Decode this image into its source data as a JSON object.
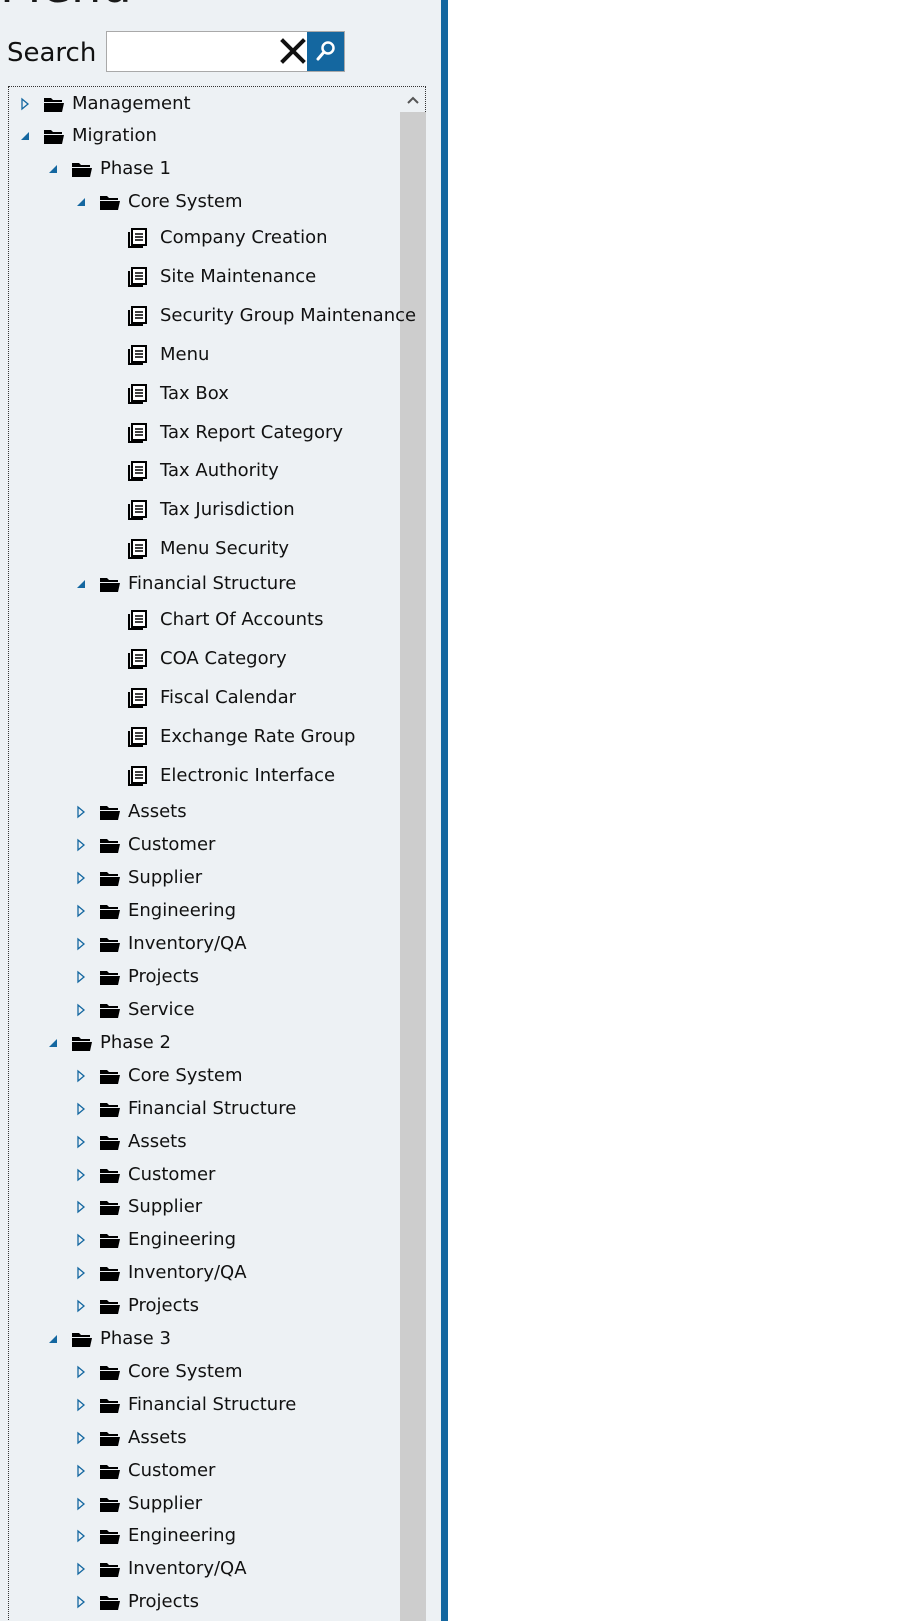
{
  "header": {
    "title": "Menu"
  },
  "search": {
    "label": "Search",
    "value": "",
    "placeholder": ""
  },
  "tree": [
    {
      "label": "Management",
      "type": "folder",
      "level": 0,
      "expanded": false
    },
    {
      "label": "Migration",
      "type": "folder",
      "level": 0,
      "expanded": true
    },
    {
      "label": "Phase 1",
      "type": "folder",
      "level": 1,
      "expanded": true
    },
    {
      "label": "Core System",
      "type": "folder",
      "level": 2,
      "expanded": true
    },
    {
      "label": "Company Creation",
      "type": "doc",
      "level": 3
    },
    {
      "label": "Site Maintenance",
      "type": "doc",
      "level": 3
    },
    {
      "label": "Security Group Maintenance",
      "type": "doc",
      "level": 3
    },
    {
      "label": "Menu",
      "type": "doc",
      "level": 3
    },
    {
      "label": "Tax Box",
      "type": "doc",
      "level": 3
    },
    {
      "label": "Tax Report Category",
      "type": "doc",
      "level": 3
    },
    {
      "label": "Tax Authority",
      "type": "doc",
      "level": 3
    },
    {
      "label": "Tax Jurisdiction",
      "type": "doc",
      "level": 3
    },
    {
      "label": "Menu Security",
      "type": "doc",
      "level": 3
    },
    {
      "label": "Financial Structure",
      "type": "folder",
      "level": 2,
      "expanded": true
    },
    {
      "label": "Chart Of Accounts",
      "type": "doc",
      "level": 3
    },
    {
      "label": "COA Category",
      "type": "doc",
      "level": 3
    },
    {
      "label": "Fiscal Calendar",
      "type": "doc",
      "level": 3
    },
    {
      "label": "Exchange Rate Group",
      "type": "doc",
      "level": 3
    },
    {
      "label": "Electronic Interface",
      "type": "doc",
      "level": 3
    },
    {
      "label": "Assets",
      "type": "folder",
      "level": 2,
      "expanded": false
    },
    {
      "label": "Customer",
      "type": "folder",
      "level": 2,
      "expanded": false
    },
    {
      "label": "Supplier",
      "type": "folder",
      "level": 2,
      "expanded": false
    },
    {
      "label": "Engineering",
      "type": "folder",
      "level": 2,
      "expanded": false
    },
    {
      "label": "Inventory/QA",
      "type": "folder",
      "level": 2,
      "expanded": false
    },
    {
      "label": "Projects",
      "type": "folder",
      "level": 2,
      "expanded": false
    },
    {
      "label": "Service",
      "type": "folder",
      "level": 2,
      "expanded": false
    },
    {
      "label": "Phase 2",
      "type": "folder",
      "level": 1,
      "expanded": true
    },
    {
      "label": "Core System",
      "type": "folder",
      "level": 2,
      "expanded": false
    },
    {
      "label": "Financial Structure",
      "type": "folder",
      "level": 2,
      "expanded": false
    },
    {
      "label": "Assets",
      "type": "folder",
      "level": 2,
      "expanded": false
    },
    {
      "label": "Customer",
      "type": "folder",
      "level": 2,
      "expanded": false
    },
    {
      "label": "Supplier",
      "type": "folder",
      "level": 2,
      "expanded": false
    },
    {
      "label": "Engineering",
      "type": "folder",
      "level": 2,
      "expanded": false
    },
    {
      "label": "Inventory/QA",
      "type": "folder",
      "level": 2,
      "expanded": false
    },
    {
      "label": "Projects",
      "type": "folder",
      "level": 2,
      "expanded": false
    },
    {
      "label": "Phase 3",
      "type": "folder",
      "level": 1,
      "expanded": true
    },
    {
      "label": "Core System",
      "type": "folder",
      "level": 2,
      "expanded": false
    },
    {
      "label": "Financial Structure",
      "type": "folder",
      "level": 2,
      "expanded": false
    },
    {
      "label": "Assets",
      "type": "folder",
      "level": 2,
      "expanded": false
    },
    {
      "label": "Customer",
      "type": "folder",
      "level": 2,
      "expanded": false
    },
    {
      "label": "Supplier",
      "type": "folder",
      "level": 2,
      "expanded": false
    },
    {
      "label": "Engineering",
      "type": "folder",
      "level": 2,
      "expanded": false
    },
    {
      "label": "Inventory/QA",
      "type": "folder",
      "level": 2,
      "expanded": false
    },
    {
      "label": "Projects",
      "type": "folder",
      "level": 2,
      "expanded": false
    }
  ],
  "colors": {
    "accent": "#1467a0",
    "panel_bg": "#edf1f4",
    "scrollbar": "#cdcdcd"
  }
}
